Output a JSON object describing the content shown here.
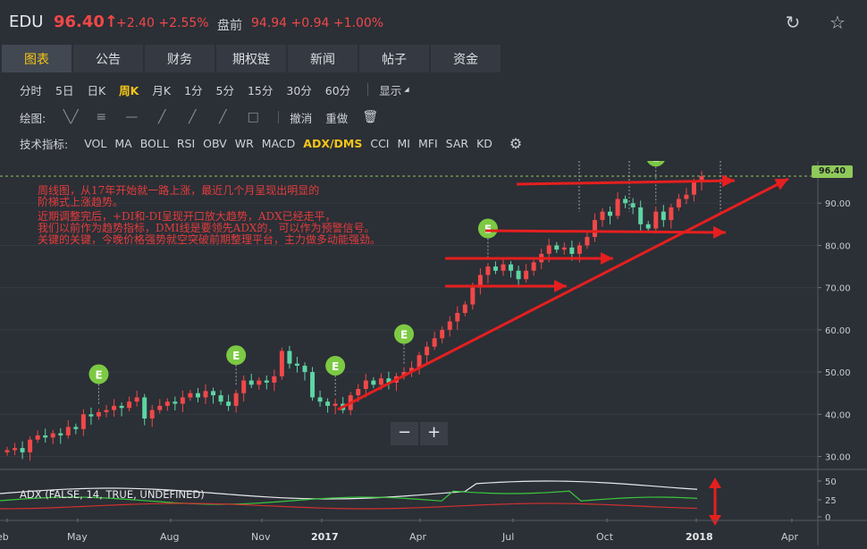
{
  "header": {
    "ticker": "EDU",
    "price": "96.40↑",
    "change": "+2.40 +2.55%",
    "premarket_label": "盘前",
    "premarket": "94.94 +0.94 +1.00%",
    "icons": [
      "refresh-icon",
      "star-icon"
    ]
  },
  "tabs": [
    "图表",
    "公告",
    "财务",
    "期权链",
    "新闻",
    "帖子",
    "资金"
  ],
  "periods": [
    "分时",
    "5日",
    "日K",
    "周K",
    "月K",
    "1分",
    "5分",
    "15分",
    "30分",
    "60分"
  ],
  "display_label": "显示",
  "draw": {
    "label": "绘图:",
    "undo": "撤消",
    "redo": "重做",
    "tools": [
      "zigzag-tool-icon",
      "fib-tool-icon",
      "horizontal-line-icon",
      "trend-line-icon",
      "ray-line-icon",
      "extended-line-icon",
      "rectangle-tool-icon",
      "trash-icon"
    ]
  },
  "indicators": {
    "label": "技术指标:",
    "items": [
      "VOL",
      "MA",
      "BOLL",
      "RSI",
      "OBV",
      "WR",
      "MACD",
      "ADX/DMS",
      "CCI",
      "MI",
      "MFI",
      "SAR",
      "KD"
    ],
    "active": "ADX/DMS"
  },
  "annotation": [
    "周线图，从17年开始就一路上涨，最近几个月呈现出明显的",
    "阶梯式上涨趋势。",
    "近期调整完后，+DI和-DI呈现开口放大趋势，ADX已经走平，",
    "我们以前作为趋势指标，DMI线是要领先ADX的，可以作为预警信号。",
    "关键的关键，今晚价格强势就空突破前期整理平台，主力做多动能强劲。"
  ],
  "zoom": {
    "minus": "−",
    "plus": "+"
  },
  "last_price_tag": "96.40",
  "adx_label": "ADX (FALSE, 14, TRUE, UNDEFINED)",
  "earnings_marker": "E",
  "colors": {
    "up": "#f04848",
    "down": "#5ed4a4",
    "accent": "#f5c518",
    "arrow": "#e51f1f"
  },
  "chart_data": {
    "type": "candlestick",
    "y_ticks": [
      30,
      40,
      50,
      60,
      70,
      80,
      90
    ],
    "y_tick_labels": [
      "30.00",
      "40.00",
      "50.00",
      "60.00",
      "70.00",
      "80.00",
      "90.00"
    ],
    "x_tick_labels": [
      "eb",
      "May",
      "Aug",
      "Nov",
      "2017",
      "Apr",
      "Jul",
      "Oct",
      "2018",
      "Apr"
    ],
    "ylim": [
      28,
      100
    ],
    "closes": [
      31.5,
      32,
      31,
      34,
      35,
      34.5,
      35.5,
      35,
      37,
      36.5,
      40,
      39.5,
      40.5,
      41,
      42,
      41.5,
      43,
      44,
      39,
      41,
      42,
      43,
      42.5,
      44,
      45,
      44,
      45.5,
      44.5,
      43,
      42,
      45,
      48,
      47,
      48,
      47.5,
      49,
      55,
      52,
      51.5,
      50,
      44,
      43,
      42,
      42.5,
      41,
      44.5,
      46,
      48,
      47,
      48.5,
      47.5,
      49,
      50,
      51,
      54,
      56,
      58,
      60,
      62,
      64,
      66,
      70,
      73,
      75,
      74,
      75.5,
      74,
      72,
      74,
      76,
      78,
      80,
      79,
      79.5,
      78,
      80,
      82,
      86,
      88,
      87,
      91,
      90,
      89,
      85,
      84,
      88,
      86,
      89,
      91,
      92,
      95,
      96.4
    ],
    "adx": {
      "ticks": [
        "50",
        "25",
        "0"
      ]
    },
    "earnings_count": 7,
    "annotation_arrows": 6
  }
}
